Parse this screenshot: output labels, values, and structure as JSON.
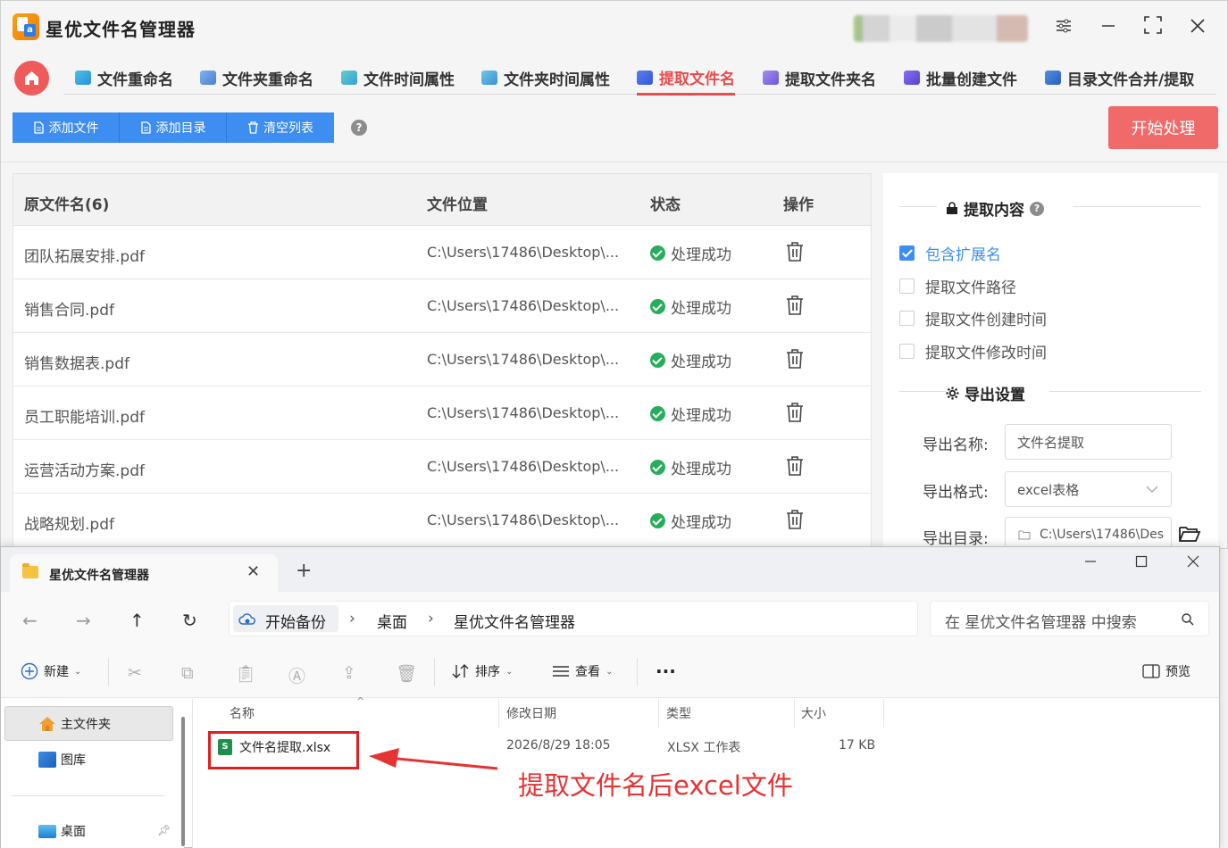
{
  "app": {
    "title": "星优文件名管理器",
    "nav_tabs": [
      {
        "label": "文件重命名",
        "active": false
      },
      {
        "label": "文件夹重命名",
        "active": false
      },
      {
        "label": "文件时间属性",
        "active": false
      },
      {
        "label": "文件夹时间属性",
        "active": false
      },
      {
        "label": "提取文件名",
        "active": true
      },
      {
        "label": "提取文件夹名",
        "active": false
      },
      {
        "label": "批量创建文件",
        "active": false
      },
      {
        "label": "目录文件合并/提取",
        "active": false
      }
    ],
    "toolbar": {
      "add_file": "添加文件",
      "add_dir": "添加目录",
      "clear_list": "清空列表",
      "help": "?",
      "start": "开始处理"
    },
    "table": {
      "headers": {
        "name": "原文件名(6)",
        "location": "文件位置",
        "status": "状态",
        "action": "操作"
      },
      "rows": [
        {
          "name": "团队拓展安排.pdf",
          "location": "C:\\Users\\17486\\Desktop\\...",
          "status": "处理成功"
        },
        {
          "name": "销售合同.pdf",
          "location": "C:\\Users\\17486\\Desktop\\...",
          "status": "处理成功"
        },
        {
          "name": "销售数据表.pdf",
          "location": "C:\\Users\\17486\\Desktop\\...",
          "status": "处理成功"
        },
        {
          "name": "员工职能培训.pdf",
          "location": "C:\\Users\\17486\\Desktop\\...",
          "status": "处理成功"
        },
        {
          "name": "运营活动方案.pdf",
          "location": "C:\\Users\\17486\\Desktop\\...",
          "status": "处理成功"
        },
        {
          "name": "战略规划.pdf",
          "location": "C:\\Users\\17486\\Desktop\\...",
          "status": "处理成功"
        }
      ]
    },
    "side": {
      "extract_title": "提取内容",
      "options": [
        {
          "label": "包含扩展名",
          "checked": true
        },
        {
          "label": "提取文件路径",
          "checked": false
        },
        {
          "label": "提取文件创建时间",
          "checked": false
        },
        {
          "label": "提取文件修改时间",
          "checked": false
        }
      ],
      "export_title": "导出设置",
      "export_name_label": "导出名称:",
      "export_name_value": "文件名提取",
      "export_format_label": "导出格式:",
      "export_format_value": "excel表格",
      "export_dir_label": "导出目录:",
      "export_dir_value": "C:\\Users\\17486\\Des"
    }
  },
  "explorer": {
    "tab_title": "星优文件名管理器",
    "breadcrumb": [
      "开始备份",
      "桌面",
      "星优文件名管理器"
    ],
    "search_placeholder": "在 星优文件名管理器 中搜索",
    "cmd": {
      "new": "新建",
      "sort": "排序",
      "view": "查看",
      "more": "...",
      "preview": "预览"
    },
    "sidebar": {
      "home": "主文件夹",
      "gallery": "图库",
      "desktop": "桌面"
    },
    "columns": {
      "name": "名称",
      "date": "修改日期",
      "type": "类型",
      "size": "大小"
    },
    "file": {
      "name": "文件名提取.xlsx",
      "date": "2026/8/29 18:05",
      "type": "XLSX 工作表",
      "size": "17 KB"
    }
  },
  "annotation": "提取文件名后excel文件",
  "colors": {
    "accent_red": "#e84c4c",
    "accent_blue": "#3d8ef0",
    "success_green": "#27ae5b"
  }
}
